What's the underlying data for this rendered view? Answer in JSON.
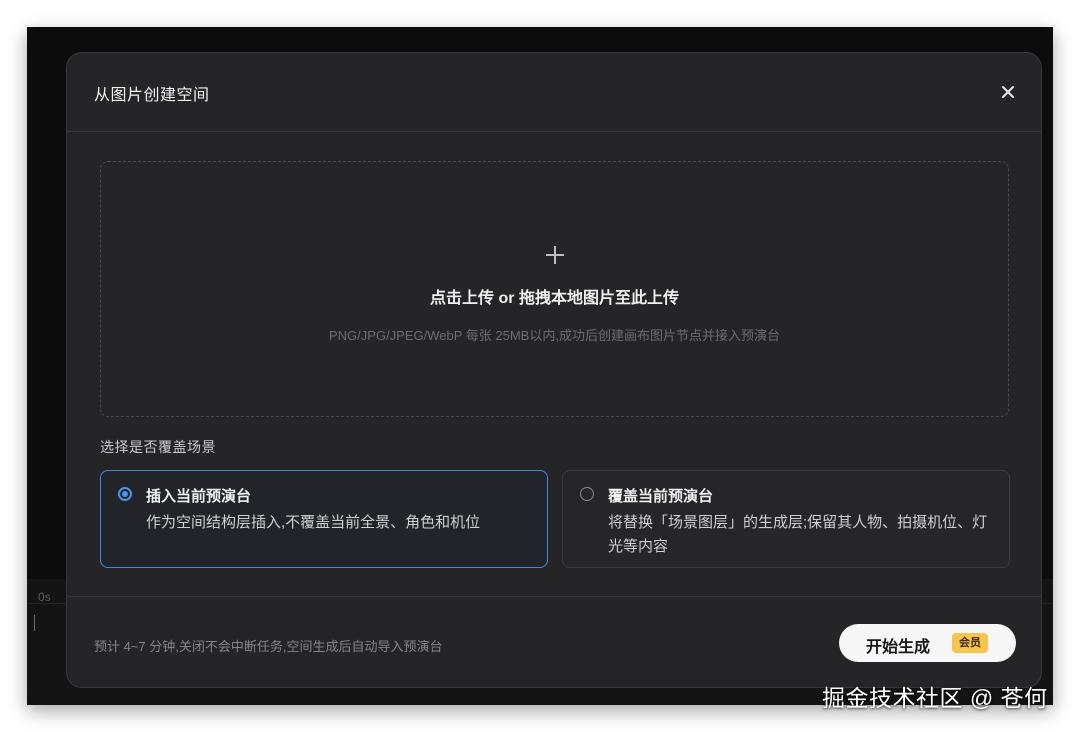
{
  "background": {
    "timeline_time": "0s"
  },
  "modal": {
    "title": "从图片创建空间",
    "close_icon": "close-icon",
    "upload": {
      "icon": "plus-icon",
      "main_text": "点击上传 or 拖拽本地图片至此上传",
      "hint_text": "PNG/JPG/JPEG/WebP 每张 25MB以内,成功后创建画布图片节点并接入预演台"
    },
    "section_label": "选择是否覆盖场景",
    "options": [
      {
        "title": "插入当前预演台",
        "description": "作为空间结构层插入,不覆盖当前全景、角色和机位",
        "selected": true
      },
      {
        "title": "覆盖当前预演台",
        "description": "将替换「场景图层」的生成层;保留其人物、拍摄机位、灯光等内容",
        "selected": false
      }
    ],
    "footer": {
      "note": "预计 4~7 分钟,关闭不会中断任务,空间生成后自动导入预演台",
      "start_button_label": "开始生成",
      "vip_badge": "会员"
    }
  },
  "watermark": "掘金技术社区 @ 苍何",
  "colors": {
    "accent": "#3d8ae8",
    "modal_bg": "#252527",
    "badge": "#f6c54f"
  }
}
